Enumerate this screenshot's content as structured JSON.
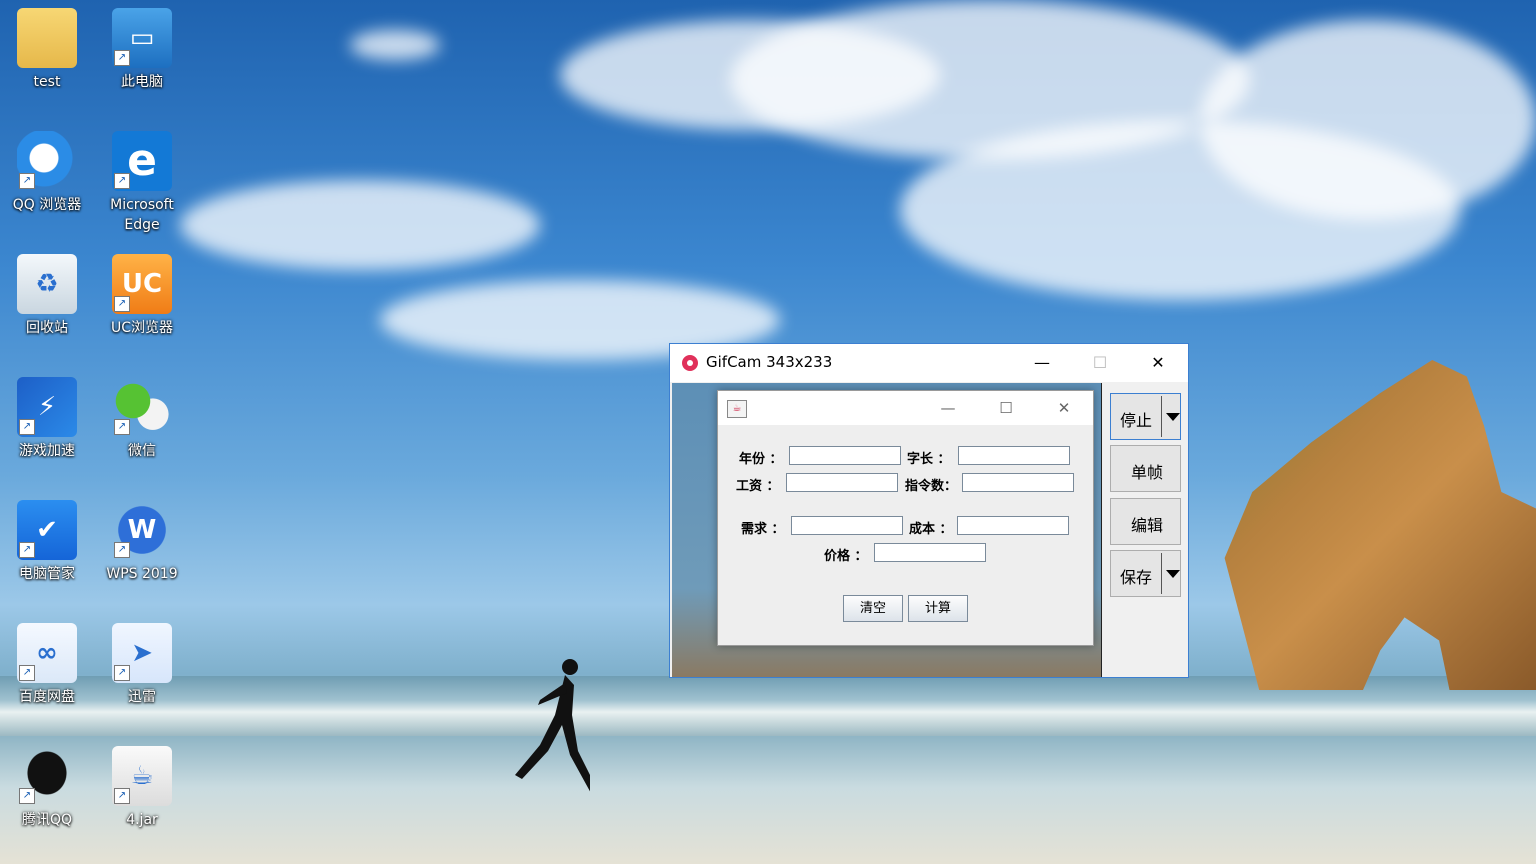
{
  "desktop": {
    "icons": [
      {
        "label": "test",
        "icon": "folder-icon"
      },
      {
        "label": "此电脑",
        "icon": "computer-icon"
      },
      {
        "label": "QQ 浏览器",
        "icon": "qq-browser-icon"
      },
      {
        "label": "Microsoft Edge",
        "icon": "edge-icon"
      },
      {
        "label": "回收站",
        "icon": "recycle-bin-icon"
      },
      {
        "label": "UC浏览器",
        "icon": "uc-browser-icon"
      },
      {
        "label": "游戏加速",
        "icon": "game-accelerator-icon"
      },
      {
        "label": "微信",
        "icon": "wechat-icon"
      },
      {
        "label": "电脑管家",
        "icon": "pc-manager-icon"
      },
      {
        "label": "WPS 2019",
        "icon": "wps-icon"
      },
      {
        "label": "百度网盘",
        "icon": "baidu-netdisk-icon"
      },
      {
        "label": "迅雷",
        "icon": "xunlei-icon"
      },
      {
        "label": "腾讯QQ",
        "icon": "qq-icon"
      },
      {
        "label": "4.jar",
        "icon": "java-jar-icon"
      }
    ]
  },
  "gifcam": {
    "title": "GifCam 343x233",
    "minimize": "—",
    "maximize": "☐",
    "close": "✕",
    "buttons": {
      "stop": "停止",
      "single_frame": "单帧",
      "edit": "编辑",
      "save": "保存"
    }
  },
  "dialog": {
    "minimize": "—",
    "maximize": "☐",
    "close": "✕",
    "labels": {
      "year": "年份 ：",
      "word_length": "字长 ：",
      "salary": "工资 ：",
      "instruction_count": "指令数：",
      "demand": "需求 ：",
      "cost": "成本 ：",
      "price": "价格 ："
    },
    "fields": {
      "year": "",
      "word_length": "",
      "salary": "",
      "instruction_count": "",
      "demand": "",
      "cost": "",
      "price": ""
    },
    "buttons": {
      "clear": "清空",
      "calculate": "计算"
    }
  },
  "colors": {
    "accent": "#3c7fd1",
    "gifcam_logo": "#e0305a"
  }
}
